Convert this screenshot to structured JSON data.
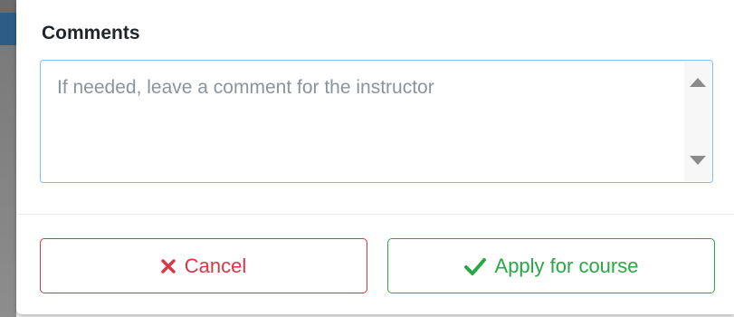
{
  "comments": {
    "label": "Comments",
    "placeholder": "If needed, leave a comment for the instructor",
    "value": ""
  },
  "footer": {
    "cancel_label": "Cancel",
    "apply_label": "Apply for course"
  },
  "colors": {
    "danger": "#dc3545",
    "success": "#28a745",
    "focus_border": "#80bdff"
  },
  "icons": {
    "cancel": "times-icon",
    "apply": "check-icon",
    "scroll_up": "arrow-up-icon",
    "scroll_down": "arrow-down-icon"
  }
}
